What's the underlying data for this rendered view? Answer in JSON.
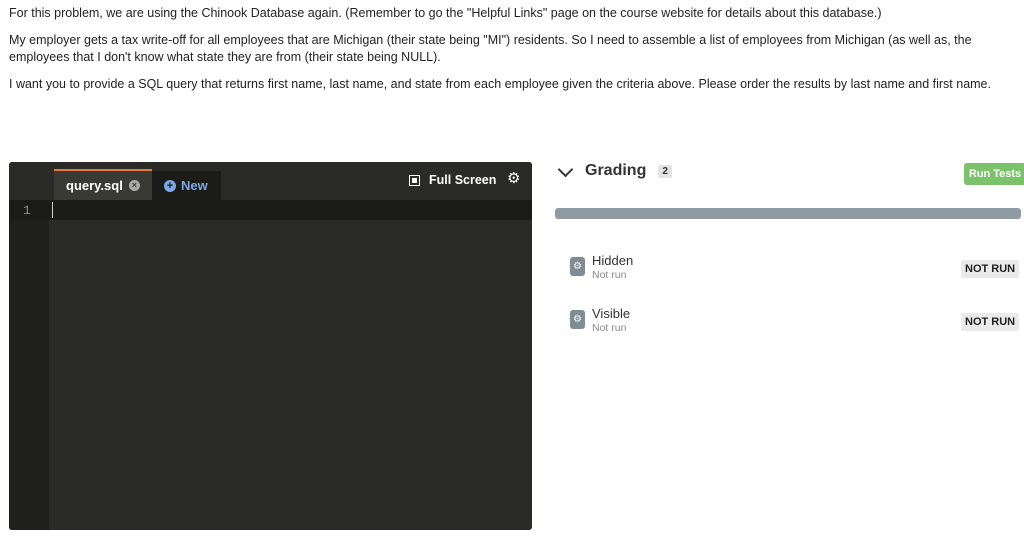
{
  "instructions": {
    "p1": "For this problem, we are using the Chinook Database again. (Remember to go the \"Helpful Links\" page on the course website for details about this database.)",
    "p2": "My employer gets a tax write-off for all employees that are Michigan (their state being \"MI\") residents. So I need to assemble a list of employees from Michigan (as well as, the employees that I don't know what state they are from (their state being NULL).",
    "p3": "I want you to provide a SQL query that returns first name, last name,  and state from each employee given the criteria above. Please order the results by last name and first name."
  },
  "editor": {
    "tab_label": "query.sql",
    "new_label": "New",
    "fullscreen_label": "Full Screen",
    "line_number": "1",
    "content": "",
    "accent": "#e07a35",
    "icons": [
      "close-icon",
      "plus-circle-icon",
      "fullscreen-icon",
      "gear-icon"
    ]
  },
  "grading": {
    "title": "Grading",
    "count": "2",
    "run_button": "Run Tests",
    "run_color": "#7cc26a",
    "progress_color": "#8e9ba3",
    "tests": [
      {
        "name": "Hidden",
        "sub": "Not run",
        "status": "NOT RUN"
      },
      {
        "name": "Visible",
        "sub": "Not run",
        "status": "NOT RUN"
      }
    ]
  }
}
